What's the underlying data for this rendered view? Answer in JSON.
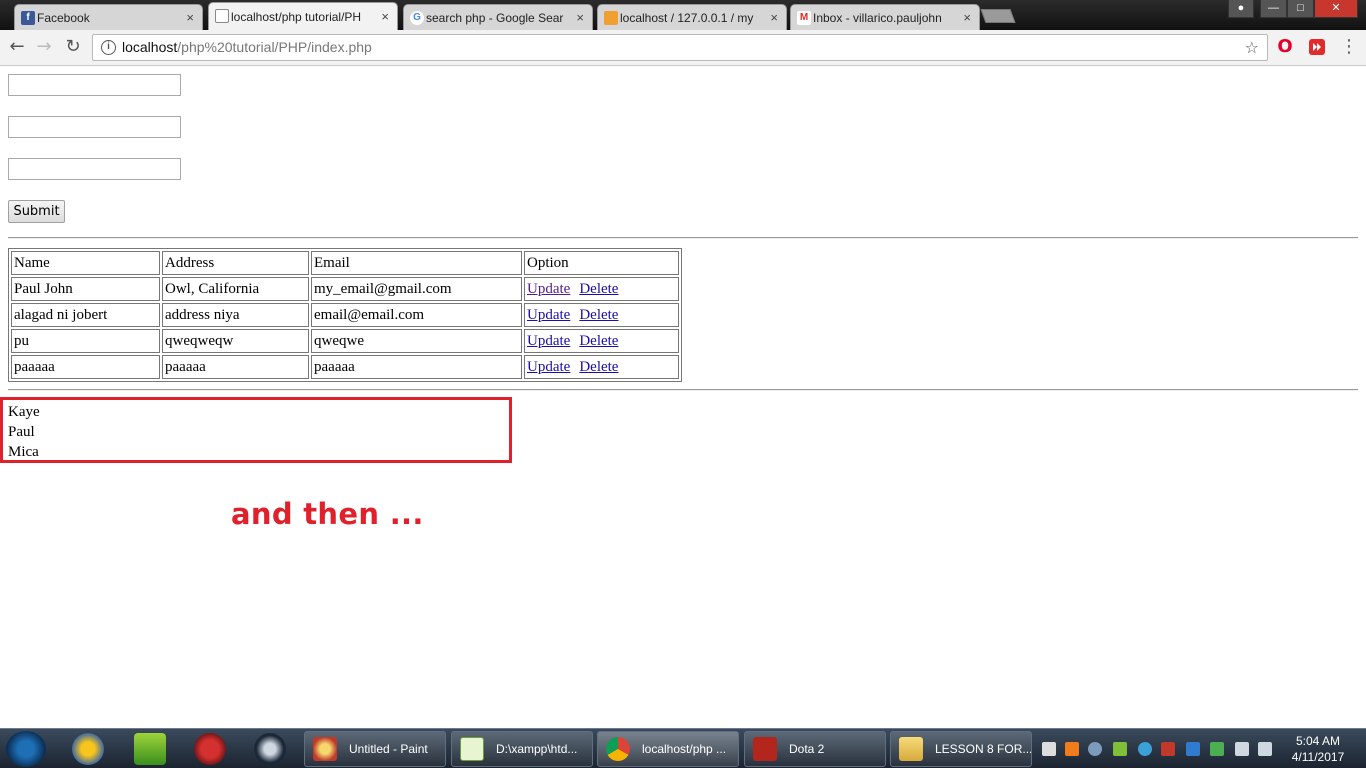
{
  "browser": {
    "tabs": [
      {
        "title": "Facebook",
        "icon": "facebook-icon",
        "active": false
      },
      {
        "title": "localhost/php tutorial/PH",
        "icon": "page-icon",
        "active": true
      },
      {
        "title": "search php - Google Sear",
        "icon": "google-icon",
        "active": false
      },
      {
        "title": "localhost / 127.0.0.1 / my",
        "icon": "phpmyadmin-icon",
        "active": false
      },
      {
        "title": "Inbox - villarico.pauljohn",
        "icon": "gmail-icon",
        "active": false
      }
    ],
    "close_glyph": "×",
    "url_host": "localhost",
    "url_path": "/php%20tutorial/PHP/index.php"
  },
  "form": {
    "field1_value": "",
    "field2_value": "",
    "field3_value": "",
    "submit_label": "Submit"
  },
  "table": {
    "headers": [
      "Name",
      "Address",
      "Email",
      "Option"
    ],
    "rows": [
      {
        "name": "Paul John",
        "address": "Owl, California",
        "email": "my_email@gmail.com"
      },
      {
        "name": "alagad ni jobert",
        "address": "address niya",
        "email": "email@email.com"
      },
      {
        "name": "pu",
        "address": "qweqweqw",
        "email": "qweqwe"
      },
      {
        "name": "paaaaa",
        "address": "paaaaa",
        "email": "paaaaa"
      }
    ],
    "update_label": "Update",
    "delete_label": "Delete"
  },
  "names_list": [
    "Kaye",
    "Paul",
    "Mica"
  ],
  "annotation": "and then ...",
  "taskbar": {
    "buttons": [
      {
        "label": "Untitled - Paint",
        "icon": "paint-icon"
      },
      {
        "label": "D:\\xampp\\htd...",
        "icon": "notepadpp-icon"
      },
      {
        "label": "localhost/php ...",
        "icon": "chrome-icon"
      },
      {
        "label": "Dota 2",
        "icon": "dota2-icon"
      },
      {
        "label": "LESSON 8 FOR...",
        "icon": "folder-icon"
      }
    ],
    "time": "5:04 AM",
    "date": "4/11/2017"
  },
  "colors": {
    "annotation_red": "#e0212c",
    "link_blue": "#1a0dab",
    "link_visited": "#551a8b"
  }
}
